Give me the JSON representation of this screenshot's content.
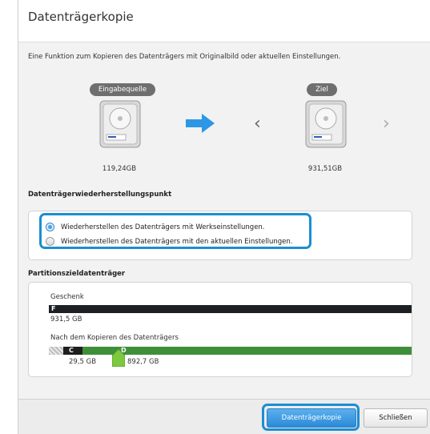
{
  "window": {
    "title": "Datenträgerkopie"
  },
  "description": "Eine Funktion zum Kopieren des Datenträgers mit Originalbild oder aktuellen Einstellungen.",
  "source": {
    "label": "Eingabequelle",
    "size": "119,24GB"
  },
  "target": {
    "label": "Ziel",
    "size": "931,51GB"
  },
  "nav": {
    "prev": "‹",
    "next": "›"
  },
  "restore": {
    "heading": "Datenträgerwiederherstellungspunkt",
    "options": [
      {
        "label": "Wiederherstellen des Datenträgers mit Werkseinstellungen.",
        "selected": true
      },
      {
        "label": "Wiederherstellen des Datenträgers mit den aktuellen Einstellungen.",
        "selected": false
      }
    ]
  },
  "partition": {
    "heading": "Partitionszieldatenträger",
    "current_label": "Geschenk",
    "current_bar_letter": "F",
    "current_size": "931,5 GB",
    "after_label": "Nach dem Kopieren des Datenträgers",
    "after_letters": {
      "c": "C",
      "d": "D"
    },
    "after_sizes": {
      "c": "29,5 GB",
      "d": "892,7 GB"
    }
  },
  "buttons": {
    "copy": "Datenträgerkopie",
    "close": "Schließen"
  },
  "colors": {
    "accent": "#1b8ed2",
    "green": "#3f8f3a",
    "dark_bar": "#1c1f24"
  }
}
